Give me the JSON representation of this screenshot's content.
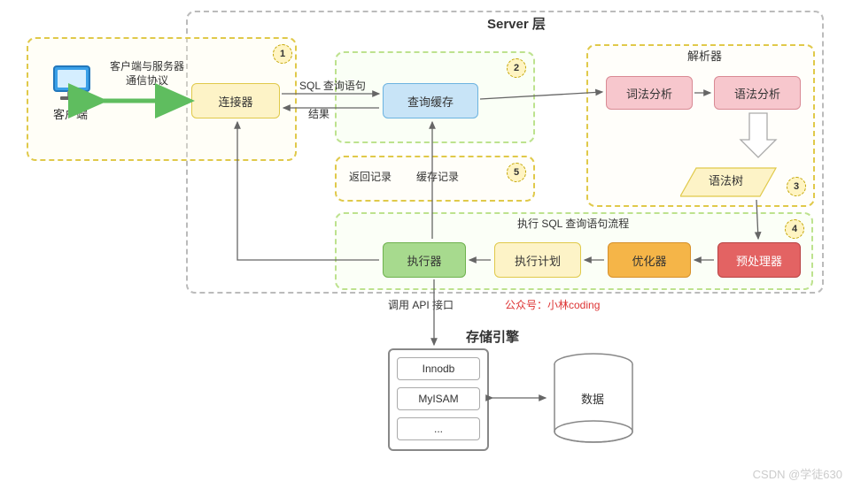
{
  "title_server": "Server 层",
  "client": {
    "label": "客户端",
    "protocol": "客户端与服务器\n通信协议"
  },
  "nodes": {
    "connector": "连接器",
    "query_cache": "查询缓存",
    "lexical": "词法分析",
    "syntax": "语法分析",
    "syntax_tree": "语法树",
    "preprocessor": "预处理器",
    "optimizer": "优化器",
    "exec_plan": "执行计划",
    "executor": "执行器"
  },
  "groups": {
    "parser_title": "解析器",
    "exec_flow_title": "执行 SQL 查询语句流程",
    "engine_title": "存储引擎"
  },
  "edges": {
    "sql_query": "SQL 查询语句",
    "result": "结果",
    "return_record": "返回记录",
    "cache_record": "缓存记录",
    "api_call": "调用 API 接口"
  },
  "engine": {
    "innodb": "Innodb",
    "myisam": "MyISAM",
    "more": "...",
    "data": "数据"
  },
  "credit": "公众号：小林coding",
  "watermark": "CSDN @学徒630",
  "numbers": {
    "n1": "1",
    "n2": "2",
    "n3": "3",
    "n4": "4",
    "n5": "5"
  }
}
